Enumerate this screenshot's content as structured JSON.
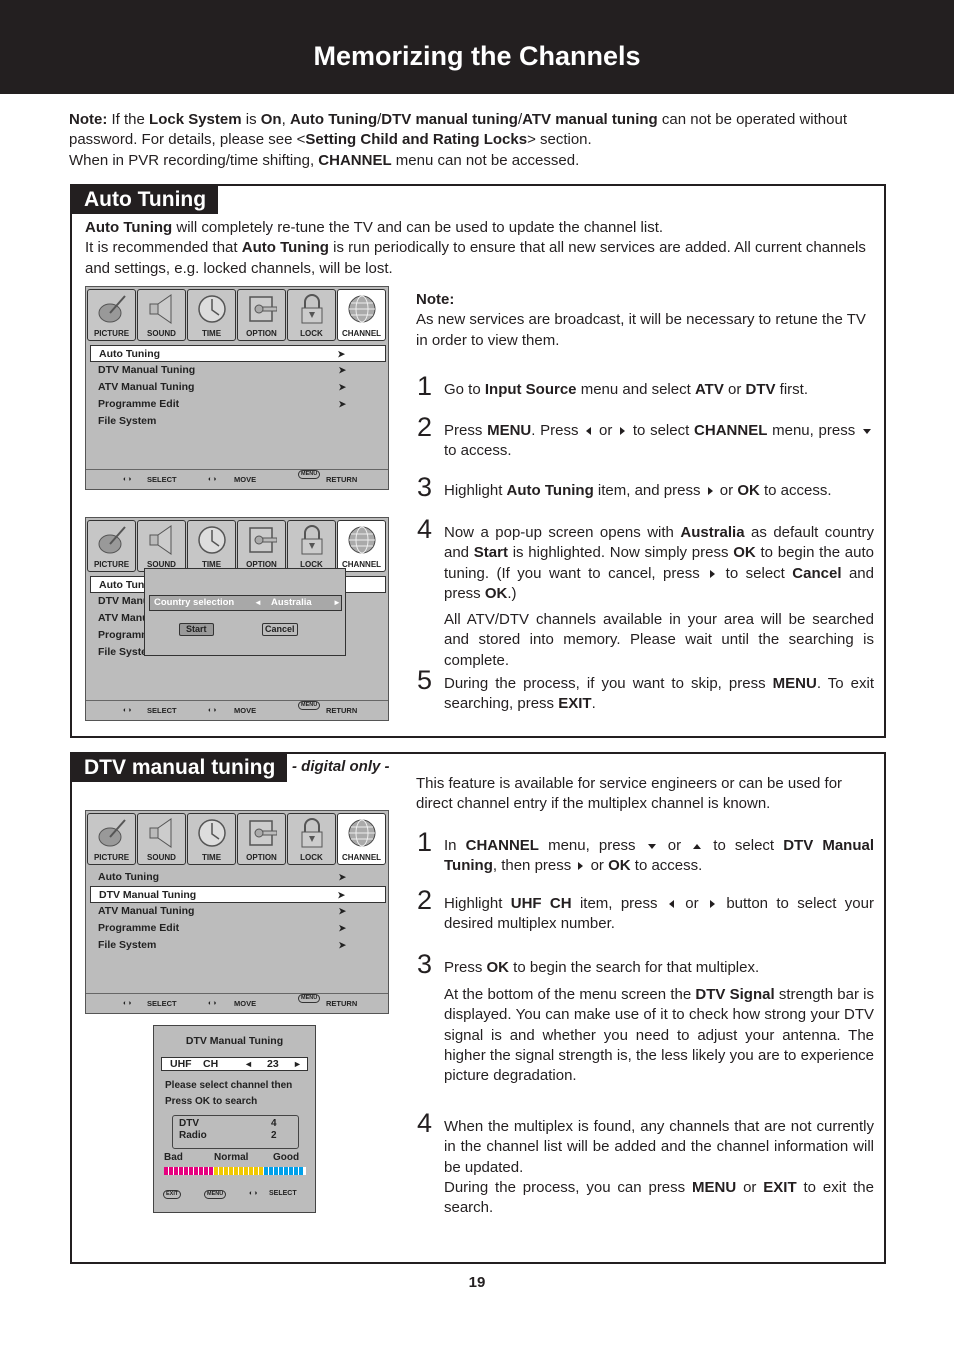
{
  "page": {
    "title": "Memorizing the Channels",
    "page_number": "19"
  },
  "note": {
    "label": "Note:",
    "line1_parts": [
      "If the ",
      "Lock System",
      " is ",
      "On",
      ", ",
      "Auto Tuning",
      "/",
      "DTV manual tuning",
      "/",
      "ATV manual tuning",
      " can not be operated without password. For details, please see <",
      "Setting Child and Rating Locks",
      "> section."
    ],
    "line2_parts": [
      "When in PVR recording/time shifting, ",
      "CHANNEL",
      " menu can not be accessed."
    ]
  },
  "auto_tuning": {
    "title": "Auto Tuning",
    "intro1_parts": [
      "Auto Tuning",
      " will completely re-tune the TV and can be used to update the channel list."
    ],
    "intro2_parts": [
      "It is recommended that ",
      "Auto Tuning",
      " is run periodically to ensure that all new services are added. All current channels and settings, e.g. locked channels, will be lost."
    ],
    "side_note_label": "Note:",
    "side_note_text": "As new services are broadcast, it will be necessary to retune the TV in order to view them.",
    "steps": [
      {
        "num": "1",
        "parts": [
          "Go to ",
          "Input Source",
          " menu and select ",
          "ATV",
          " or ",
          "DTV",
          " first."
        ]
      },
      {
        "num": "2",
        "parts": [
          "Press ",
          "MENU",
          ". Press ",
          "[left]",
          " or ",
          "[right]",
          " to select ",
          "CHANNEL",
          " menu, press ",
          "[down]",
          " to access."
        ]
      },
      {
        "num": "3",
        "parts": [
          "Highlight ",
          "Auto Tuning",
          " item, and press ",
          "[right]",
          " or ",
          "OK",
          " to access."
        ]
      },
      {
        "num": "4",
        "parts": [
          "Now a pop-up screen opens with ",
          "Australia",
          " as default country and ",
          "Start",
          " is highlighted. Now simply press ",
          "OK",
          " to begin the auto tuning. (If you want to cancel, press ",
          "[right]",
          " to select ",
          "Cancel",
          " and press ",
          "OK",
          ".)"
        ],
        "extra": "All ATV/DTV channels available in your area will be searched and stored into memory. Please wait until the searching is complete."
      },
      {
        "num": "5",
        "parts": [
          "During the process, if you want to skip, press ",
          "MENU",
          ". To exit searching, press ",
          "EXIT",
          "."
        ]
      }
    ]
  },
  "dtv_manual": {
    "title": "DTV manual tuning",
    "subtitle": "- digital only -",
    "intro": "This feature is available for service engineers or can be used for direct channel entry if the multiplex channel is known.",
    "steps": [
      {
        "num": "1",
        "parts": [
          "In ",
          "CHANNEL",
          " menu, press ",
          "[down]",
          " or ",
          "[up]",
          " to select ",
          "DTV Manual Tuning",
          ", then press ",
          "[right]",
          " or ",
          "OK",
          " to access."
        ]
      },
      {
        "num": "2",
        "parts": [
          "Highlight ",
          "UHF CH",
          " item, press ",
          "[left]",
          " or ",
          "[right]",
          " button to select your desired multiplex number."
        ]
      },
      {
        "num": "3",
        "parts": [
          "Press ",
          "OK",
          " to begin the search for that multiplex."
        ],
        "extra_parts": [
          "At the bottom of the menu screen the ",
          "DTV Signal",
          " strength bar is displayed. You can make use of it to check how strong your DTV signal is and whether you need to adjust your antenna. The higher the signal strength is, the less likely you are to experience picture degradation."
        ]
      },
      {
        "num": "4",
        "parts": [
          "When the multiplex is found, any channels that are not currently in the channel list will be added and the channel information will be updated."
        ],
        "extra_parts": [
          "During the process, you can press ",
          "MENU",
          " or ",
          "EXIT",
          " to exit the search."
        ]
      }
    ]
  },
  "osd": {
    "tabs": [
      {
        "label": "PICTURE",
        "icon": "picture-icon"
      },
      {
        "label": "SOUND",
        "icon": "speaker-icon"
      },
      {
        "label": "TIME",
        "icon": "clock-icon"
      },
      {
        "label": "OPTION",
        "icon": "option-icon"
      },
      {
        "label": "LOCK",
        "icon": "lock-icon"
      },
      {
        "label": "CHANNEL",
        "icon": "globe-icon"
      }
    ],
    "active_tab": "CHANNEL",
    "menu_items": [
      "Auto Tuning",
      "DTV Manual Tuning",
      "ATV Manual Tuning",
      "Programme Edit",
      "File System"
    ],
    "footer": {
      "select": "SELECT",
      "move": "MOVE",
      "menu_key": "MENU",
      "return": "RETURN"
    },
    "screen1_selected": "Auto Tuning",
    "screen3_selected": "DTV Manual Tuning",
    "popup": {
      "country_label": "Country  selection",
      "country_value": "Australia",
      "start": "Start",
      "cancel": "Cancel"
    }
  },
  "dtv_screen": {
    "title": "DTV Manual Tuning",
    "field_label1": "UHF",
    "field_label2": "CH",
    "channel": "23",
    "message1": "Please select channel then",
    "message2": "Press OK to search",
    "dtv_label": "DTV",
    "dtv_count": "4",
    "radio_label": "Radio",
    "radio_count": "2",
    "signal_labels": [
      "Bad",
      "Normal",
      "Good"
    ],
    "signal_segments": {
      "bad": 10,
      "normal": 10,
      "good": 8,
      "total": 30
    },
    "signal_colors": {
      "bad": "#e6007e",
      "normal": "#f0c800",
      "good": "#00a0e9"
    },
    "footer": {
      "exit": "EXIT",
      "menu": "MENU",
      "select": "SELECT"
    }
  }
}
